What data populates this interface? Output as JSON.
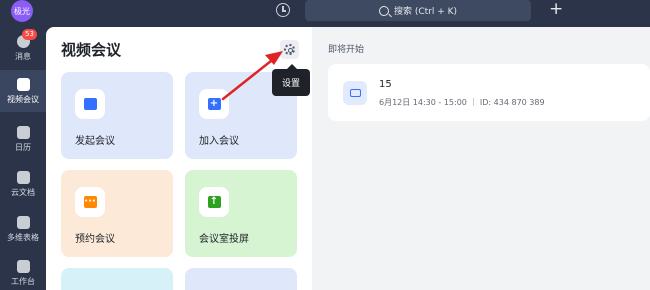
{
  "topbar": {
    "avatar_text": "极光",
    "search_label": "搜索 (Ctrl + K)"
  },
  "sidebar": {
    "items": [
      {
        "label": "消息",
        "icon": "chat-icon",
        "badge": "53"
      },
      {
        "label": "视频会议",
        "icon": "video-icon",
        "active": true
      },
      {
        "label": "日历",
        "icon": "calendar-icon"
      },
      {
        "label": "云文档",
        "icon": "document-icon"
      },
      {
        "label": "多维表格",
        "icon": "table-icon"
      },
      {
        "label": "工作台",
        "icon": "grid-icon"
      }
    ]
  },
  "left_panel": {
    "title": "视频会议",
    "settings_tooltip": "设置",
    "cards": [
      {
        "label": "发起会议",
        "icon": "video-camera-icon",
        "color": "#3370ff"
      },
      {
        "label": "加入会议",
        "icon": "plus-icon",
        "color": "#3370ff"
      },
      {
        "label": "预约会议",
        "icon": "calendar-icon",
        "color": "#ff8800"
      },
      {
        "label": "会议室投屏",
        "icon": "screen-share-icon",
        "color": "#2ea121"
      }
    ]
  },
  "right_panel": {
    "section_label": "即将开始",
    "meeting": {
      "title": "15",
      "time": "6月12日 14:30 - 15:00",
      "id_text": "ID: 434 870 389"
    }
  },
  "colors": {
    "accent_blue": "#3370ff",
    "annotation_red": "#e02424",
    "sidebar_bg": "#2b3449"
  }
}
